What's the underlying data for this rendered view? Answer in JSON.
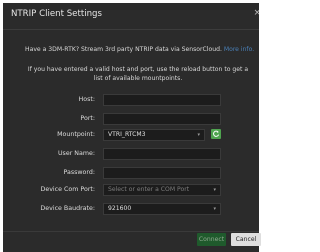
{
  "dialog": {
    "title": "NTRIP Client Settings",
    "close_glyph": "×"
  },
  "intro": {
    "text": "Have a 3DM-RTK? Stream 3rd party NTRIP data via SensorCloud.",
    "link": "More info."
  },
  "hint": "If you have entered a valid host and port, use the reload button to get a list of available mountpoints.",
  "form": {
    "host_label": "Host:",
    "host_value": "",
    "port_label": "Port:",
    "port_value": "",
    "mountpoint_label": "Mountpoint:",
    "mountpoint_value": "VTRI_RTCM3",
    "username_label": "User Name:",
    "username_value": "",
    "password_label": "Password:",
    "password_value": "",
    "comport_label": "Device Com Port:",
    "comport_placeholder": "Select or enter a COM Port",
    "baud_label": "Device Baudrate:",
    "baud_value": "921600",
    "dropdown_glyph": "▾"
  },
  "footer": {
    "connect_label": "Connect",
    "cancel_label": "Cancel"
  },
  "icons": {
    "reload": "reload-icon",
    "dropdown": "chevron-down-icon",
    "close": "close-icon"
  },
  "colors": {
    "dialog_bg": "#2b2b2b",
    "field_bg": "#1c1c1c",
    "link": "#4a80b8",
    "reload_green": "#4fa44f",
    "connect_bg": "#1f5a2c",
    "cancel_bg": "#dedede"
  }
}
